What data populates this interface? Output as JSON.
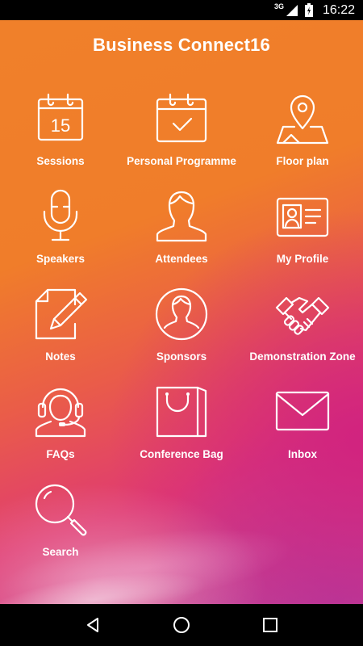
{
  "status_bar": {
    "network": "3G",
    "time": "16:22"
  },
  "app": {
    "title": "Business Connect16"
  },
  "tiles": [
    {
      "label": "Sessions",
      "icon": "calendar-15-icon",
      "day": "15"
    },
    {
      "label": "Personal Programme",
      "icon": "calendar-check-icon"
    },
    {
      "label": "Floor plan",
      "icon": "map-pin-icon"
    },
    {
      "label": "Speakers",
      "icon": "microphone-icon"
    },
    {
      "label": "Attendees",
      "icon": "person-icon"
    },
    {
      "label": "My Profile",
      "icon": "id-card-icon"
    },
    {
      "label": "Notes",
      "icon": "note-pencil-icon"
    },
    {
      "label": "Sponsors",
      "icon": "person-circle-icon"
    },
    {
      "label": "Demonstration Zone",
      "icon": "handshake-icon"
    },
    {
      "label": "FAQs",
      "icon": "headset-icon"
    },
    {
      "label": "Conference Bag",
      "icon": "shopping-bag-icon"
    },
    {
      "label": "Inbox",
      "icon": "envelope-icon"
    },
    {
      "label": "Search",
      "icon": "magnifier-icon"
    }
  ],
  "nav_bar": {
    "back": "back-icon",
    "home": "home-icon",
    "recents": "recents-icon"
  },
  "colors": {
    "orange": "#f07d2a",
    "magenta": "#d1237f",
    "text": "#ffffff"
  }
}
